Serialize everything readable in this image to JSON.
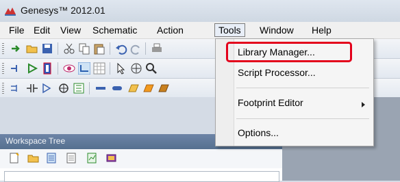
{
  "title": {
    "text": "Genesys™ 2012.01"
  },
  "menubar": {
    "items": [
      "File",
      "Edit",
      "View",
      "Schematic",
      "Action",
      "Tools",
      "Window",
      "Help"
    ],
    "active": "Tools"
  },
  "tools_menu": {
    "items": [
      {
        "label": "Library Manager..."
      },
      {
        "label": "Script Processor..."
      },
      {
        "label": "Footprint Editor"
      },
      {
        "label": "Options..."
      }
    ],
    "highlight_color": "#e3001b"
  },
  "workspace": {
    "panel_title": "Workspace Tree"
  },
  "colors": {
    "panel_header": "#5e7597",
    "menu_bg": "#f5f5f5"
  }
}
